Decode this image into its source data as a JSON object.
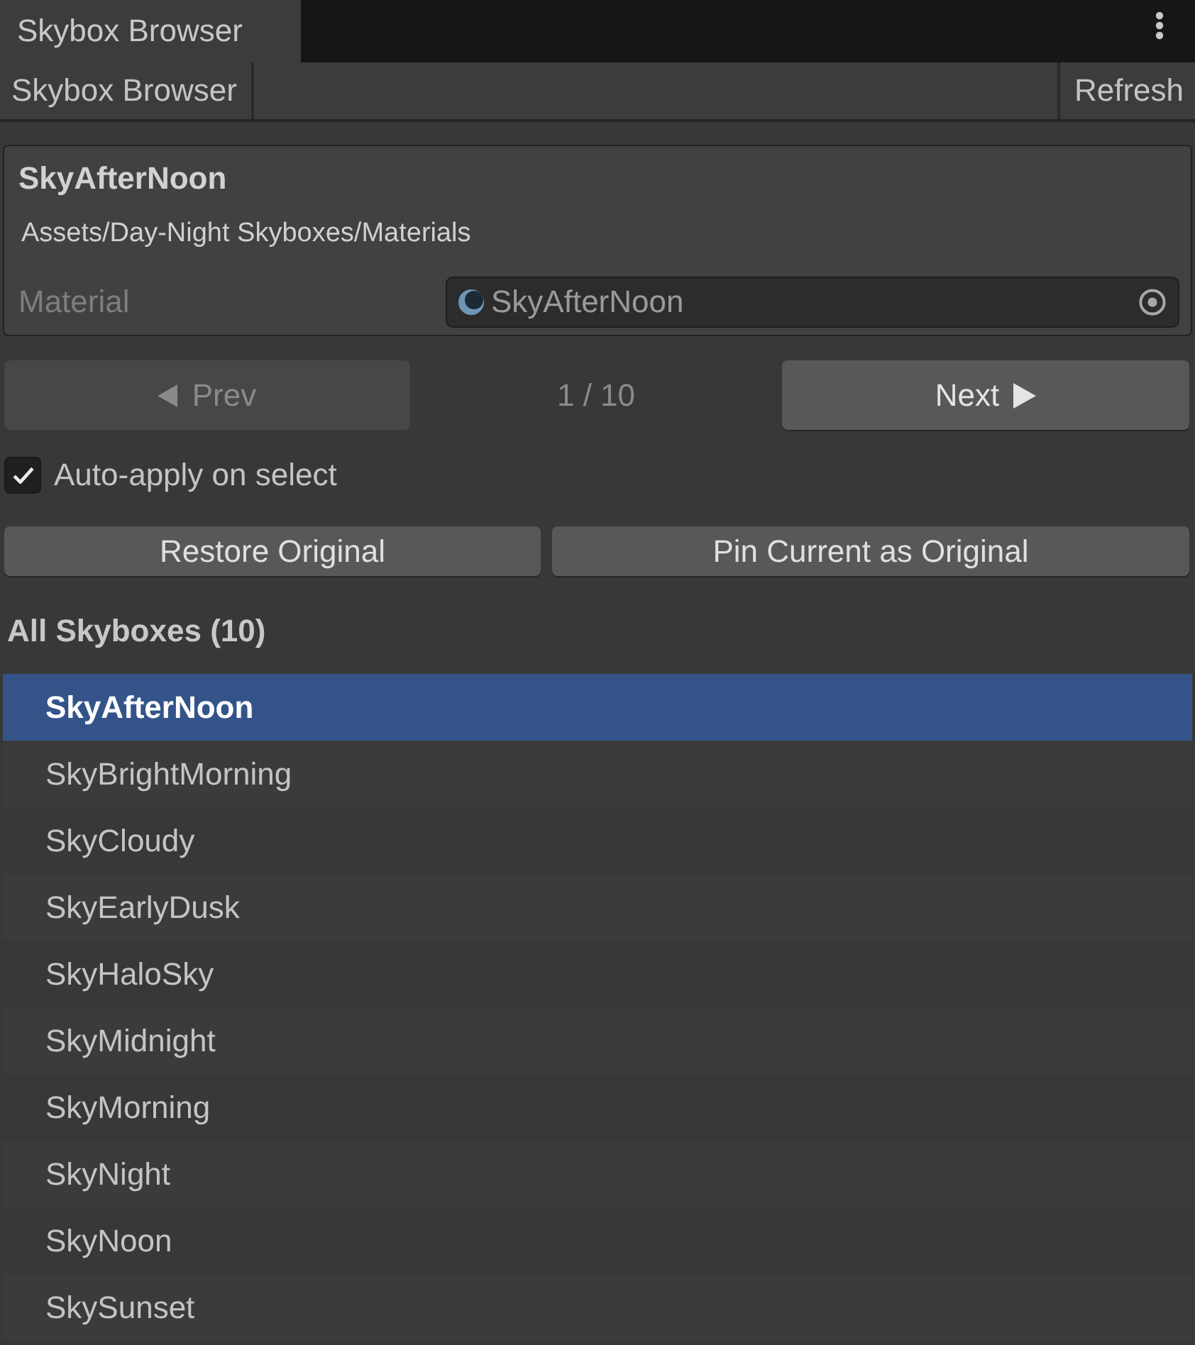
{
  "tabs": [
    {
      "title": "Skybox Browser",
      "selected": true
    }
  ],
  "toolbar": {
    "title": "Skybox Browser",
    "refresh_button": "Refresh"
  },
  "current": {
    "name": "SkyAfterNoon",
    "path": "Assets/Day-Night Skyboxes/Materials",
    "field_label": "Material",
    "field_value": "SkyAfterNoon"
  },
  "navigation": {
    "prev": {
      "label": "Prev",
      "disabled": true
    },
    "counter": "1 / 10",
    "next": {
      "label": "Next",
      "disabled": false
    }
  },
  "auto_apply": {
    "label": "Auto-apply on select",
    "checked": true
  },
  "buttons": [
    "Restore Original",
    "Pin Current as Original"
  ],
  "list": {
    "title": "All Skyboxes (10)",
    "items": [
      {
        "label": "SkyAfterNoon",
        "selected": true
      },
      {
        "label": "SkyBrightMorning",
        "selected": false
      },
      {
        "label": "SkyCloudy",
        "selected": false
      },
      {
        "label": "SkyEarlyDusk",
        "selected": false
      },
      {
        "label": "SkyHaloSky",
        "selected": false
      },
      {
        "label": "SkyMidnight",
        "selected": false
      },
      {
        "label": "SkyMorning",
        "selected": false
      },
      {
        "label": "SkyNight",
        "selected": false
      },
      {
        "label": "SkyNoon",
        "selected": false
      },
      {
        "label": "SkySunset",
        "selected": false
      }
    ]
  }
}
